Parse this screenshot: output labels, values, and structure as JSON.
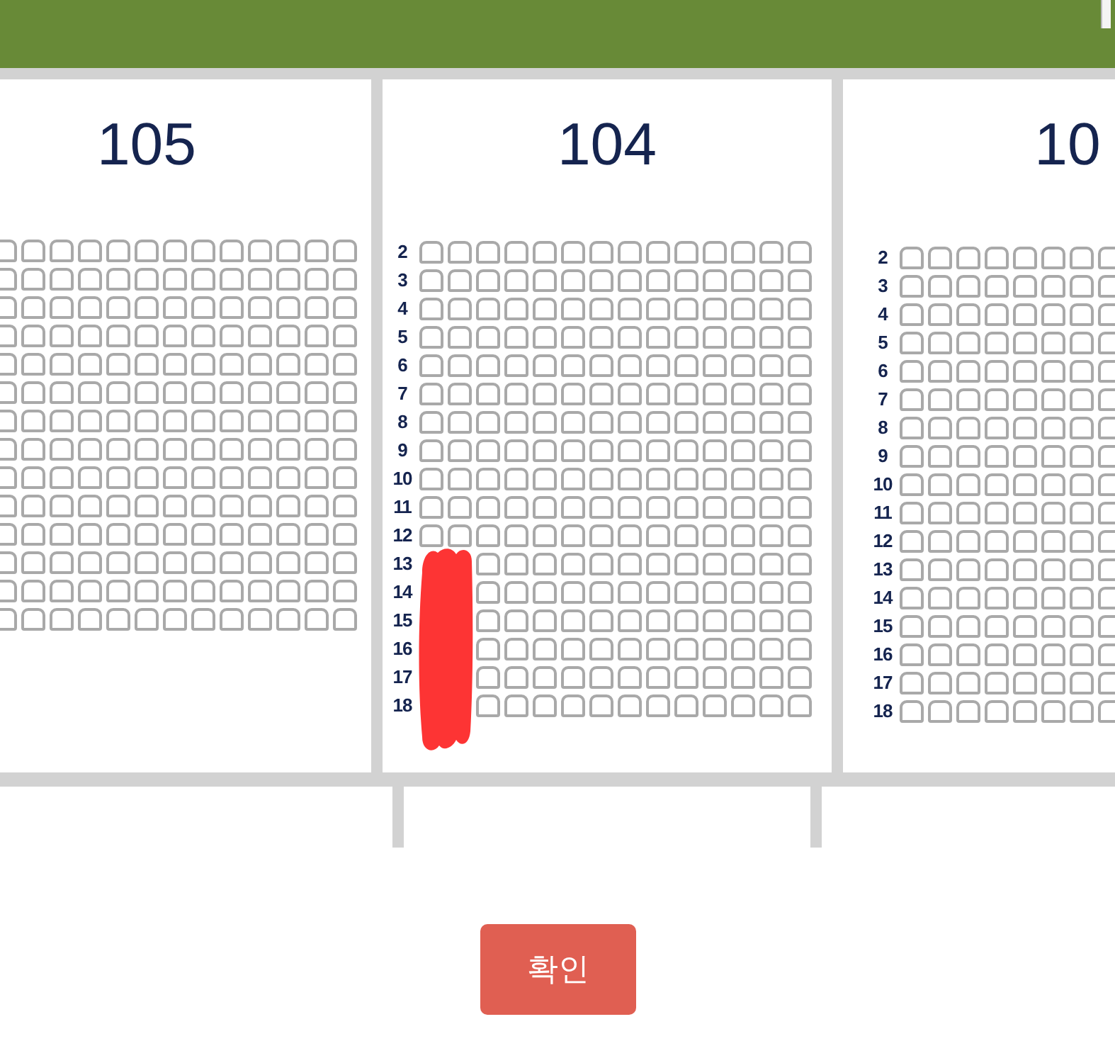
{
  "sections": [
    {
      "title": "105",
      "redacted": false,
      "rows": [
        {
          "seat_selected": [
            false,
            false,
            false,
            false,
            false,
            false,
            false,
            false,
            false,
            false,
            false,
            false,
            false
          ]
        },
        {
          "seat_selected": [
            false,
            false,
            false,
            false,
            false,
            false,
            false,
            false,
            false,
            false,
            false,
            false,
            false
          ]
        },
        {
          "seat_selected": [
            false,
            false,
            false,
            false,
            false,
            false,
            false,
            false,
            false,
            false,
            false,
            false,
            false
          ]
        },
        {
          "seat_selected": [
            false,
            false,
            false,
            false,
            false,
            false,
            false,
            false,
            false,
            false,
            false,
            false,
            false
          ]
        },
        {
          "seat_selected": [
            false,
            false,
            false,
            false,
            false,
            false,
            false,
            false,
            false,
            false,
            false,
            false,
            false
          ]
        },
        {
          "seat_selected": [
            false,
            false,
            false,
            false,
            false,
            false,
            false,
            false,
            false,
            false,
            false,
            false,
            false
          ]
        },
        {
          "seat_selected": [
            false,
            false,
            false,
            false,
            false,
            false,
            false,
            false,
            false,
            false,
            false,
            false,
            false
          ]
        },
        {
          "seat_selected": [
            false,
            false,
            false,
            false,
            false,
            false,
            false,
            false,
            false,
            false,
            false,
            false,
            false
          ]
        },
        {
          "seat_selected": [
            false,
            false,
            false,
            false,
            false,
            false,
            false,
            false,
            false,
            false,
            false,
            false,
            false
          ]
        },
        {
          "seat_selected": [
            false,
            false,
            false,
            false,
            false,
            false,
            false,
            false,
            false,
            false,
            false,
            false,
            false
          ]
        },
        {
          "seat_selected": [
            false,
            false,
            false,
            false,
            false,
            false,
            false,
            false,
            false,
            false,
            false,
            false,
            false
          ]
        },
        {
          "seat_selected": [
            false,
            false,
            false,
            false,
            false,
            false,
            false,
            false,
            false,
            false,
            false,
            false,
            false
          ]
        },
        {
          "seat_selected": [
            false,
            false,
            false,
            false,
            false,
            false,
            false,
            false,
            false,
            false,
            false,
            false,
            false
          ]
        },
        {
          "seat_selected": [
            false,
            false,
            false,
            false,
            false,
            false,
            false,
            false,
            false,
            false,
            false,
            false,
            false
          ]
        }
      ]
    },
    {
      "title": "104",
      "redacted": true,
      "rows": [
        {
          "kind": "full",
          "label": "2",
          "seat_selected": [
            false,
            false,
            false,
            false,
            false,
            false,
            false,
            false,
            false,
            false,
            false,
            false,
            false,
            false
          ]
        },
        {
          "kind": "full",
          "label": "3",
          "seat_selected": [
            false,
            false,
            false,
            false,
            false,
            false,
            false,
            false,
            false,
            false,
            false,
            false,
            false,
            false
          ]
        },
        {
          "kind": "full",
          "label": "4",
          "seat_selected": [
            false,
            false,
            false,
            false,
            false,
            false,
            false,
            false,
            false,
            false,
            false,
            false,
            false,
            false
          ]
        },
        {
          "kind": "full",
          "label": "5",
          "seat_selected": [
            false,
            false,
            false,
            false,
            false,
            false,
            false,
            false,
            false,
            false,
            false,
            false,
            false,
            false
          ]
        },
        {
          "kind": "full",
          "label": "6",
          "seat_selected": [
            false,
            false,
            false,
            false,
            false,
            false,
            false,
            false,
            false,
            false,
            false,
            false,
            false,
            false
          ]
        },
        {
          "kind": "full",
          "label": "7",
          "seat_selected": [
            false,
            false,
            false,
            false,
            false,
            false,
            false,
            false,
            false,
            false,
            false,
            false,
            false,
            false
          ]
        },
        {
          "kind": "full",
          "label": "8",
          "seat_selected": [
            false,
            false,
            false,
            false,
            false,
            false,
            false,
            false,
            false,
            false,
            false,
            false,
            false,
            false
          ]
        },
        {
          "kind": "full",
          "label": "9",
          "seat_selected": [
            false,
            false,
            false,
            false,
            false,
            false,
            false,
            false,
            false,
            false,
            false,
            false,
            false,
            false
          ]
        },
        {
          "kind": "full",
          "label": "10",
          "seat_selected": [
            false,
            false,
            false,
            false,
            false,
            false,
            false,
            false,
            false,
            false,
            false,
            false,
            false,
            false
          ]
        },
        {
          "kind": "full",
          "label": "11",
          "seat_selected": [
            false,
            false,
            false,
            false,
            false,
            false,
            false,
            false,
            false,
            false,
            false,
            false,
            false,
            false
          ]
        },
        {
          "kind": "full",
          "label": "12",
          "seat_selected": [
            false,
            false,
            false,
            false,
            false,
            false,
            false,
            false,
            false,
            false,
            false,
            false,
            false,
            false
          ]
        },
        {
          "kind": "covered",
          "label": "13",
          "seat_selected": [
            false,
            false,
            false,
            false,
            false,
            false,
            false,
            false,
            false,
            false,
            false,
            false
          ]
        },
        {
          "kind": "covered",
          "label": "14",
          "seat_selected": [
            false,
            false,
            false,
            false,
            false,
            false,
            false,
            false,
            false,
            false,
            false,
            false
          ]
        },
        {
          "kind": "covered",
          "label": "15",
          "seat_selected": [
            false,
            false,
            false,
            false,
            false,
            false,
            false,
            false,
            false,
            false,
            false,
            false
          ]
        },
        {
          "kind": "covered",
          "label": "16",
          "seat_selected": [
            false,
            false,
            false,
            false,
            false,
            false,
            false,
            false,
            false,
            false,
            false,
            false
          ]
        },
        {
          "kind": "covered",
          "label": "17",
          "seat_selected": [
            false,
            false,
            false,
            false,
            false,
            false,
            false,
            false,
            false,
            false,
            false,
            false
          ]
        },
        {
          "kind": "covered",
          "label": "18",
          "seat_selected": [
            false,
            false,
            false,
            false,
            false,
            false,
            false,
            false,
            false,
            false,
            false,
            false
          ]
        }
      ]
    },
    {
      "title": "10",
      "redacted": false,
      "rows": [
        {
          "label": "2",
          "seat_selected": [
            false,
            false,
            false,
            false,
            false,
            false,
            false,
            false
          ]
        },
        {
          "label": "3",
          "seat_selected": [
            false,
            false,
            false,
            false,
            false,
            false,
            false,
            false
          ]
        },
        {
          "label": "4",
          "seat_selected": [
            false,
            false,
            false,
            false,
            false,
            false,
            false,
            false
          ]
        },
        {
          "label": "5",
          "seat_selected": [
            false,
            false,
            false,
            false,
            false,
            false,
            false,
            false
          ]
        },
        {
          "label": "6",
          "seat_selected": [
            false,
            false,
            false,
            false,
            false,
            false,
            false,
            false
          ]
        },
        {
          "label": "7",
          "seat_selected": [
            false,
            false,
            false,
            false,
            false,
            false,
            false,
            false
          ]
        },
        {
          "label": "8",
          "seat_selected": [
            false,
            false,
            false,
            false,
            false,
            false,
            false,
            false
          ]
        },
        {
          "label": "9",
          "seat_selected": [
            false,
            false,
            false,
            false,
            false,
            false,
            false,
            false
          ]
        },
        {
          "label": "10",
          "seat_selected": [
            false,
            false,
            false,
            false,
            false,
            false,
            false,
            false
          ]
        },
        {
          "label": "11",
          "seat_selected": [
            false,
            false,
            false,
            false,
            false,
            false,
            false,
            false
          ]
        },
        {
          "label": "12",
          "seat_selected": [
            false,
            false,
            false,
            false,
            false,
            false,
            false,
            false
          ]
        },
        {
          "label": "13",
          "seat_selected": [
            false,
            false,
            false,
            false,
            false,
            false,
            false,
            false
          ]
        },
        {
          "label": "14",
          "seat_selected": [
            false,
            false,
            false,
            false,
            false,
            false,
            false,
            false
          ]
        },
        {
          "label": "15",
          "seat_selected": [
            false,
            false,
            false,
            false,
            false,
            false,
            false,
            false
          ]
        },
        {
          "label": "16",
          "seat_selected": [
            false,
            false,
            false,
            false,
            false,
            false,
            false,
            false
          ]
        },
        {
          "label": "17",
          "seat_selected": [
            false,
            false,
            false,
            false,
            false,
            false,
            false,
            false
          ]
        },
        {
          "label": "18",
          "seat_selected": [
            false,
            false,
            false,
            false,
            false,
            false,
            false,
            false
          ]
        }
      ]
    }
  ],
  "confirm_button": {
    "label": "확인"
  }
}
